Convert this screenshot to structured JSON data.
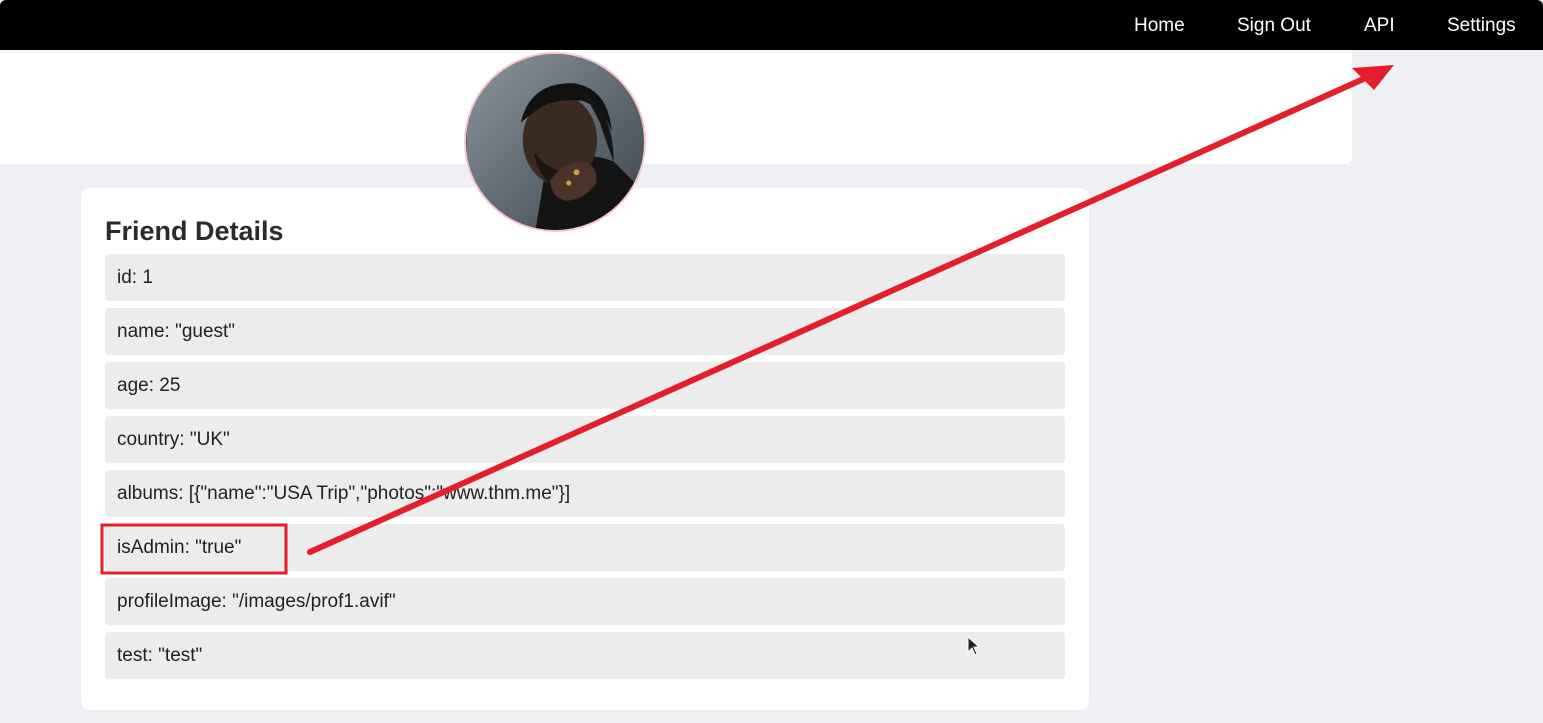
{
  "nav": {
    "home": "Home",
    "sign_out": "Sign Out",
    "api": "API",
    "settings": "Settings"
  },
  "avatar": {
    "icon": "profile-photo"
  },
  "friend_details": {
    "title": "Friend Details",
    "rows": [
      {
        "text": "id: 1"
      },
      {
        "text": "name: \"guest\""
      },
      {
        "text": "age: 25"
      },
      {
        "text": "country: \"UK\""
      },
      {
        "text": "albums: [{\"name\":\"USA Trip\",\"photos\":\"www.thm.me\"}]"
      },
      {
        "text": "isAdmin: \"true\""
      },
      {
        "text": "profileImage: \"/images/prof1.avif\""
      },
      {
        "text": "test: \"test\""
      }
    ]
  },
  "annotation": {
    "color": "#e41e2b",
    "highlighted_row": "isAdmin",
    "arrow_points_to": "Settings"
  },
  "colors": {
    "nav_bg": "#000000",
    "page_bg": "#eff0f3",
    "row_bg": "#ececec"
  }
}
